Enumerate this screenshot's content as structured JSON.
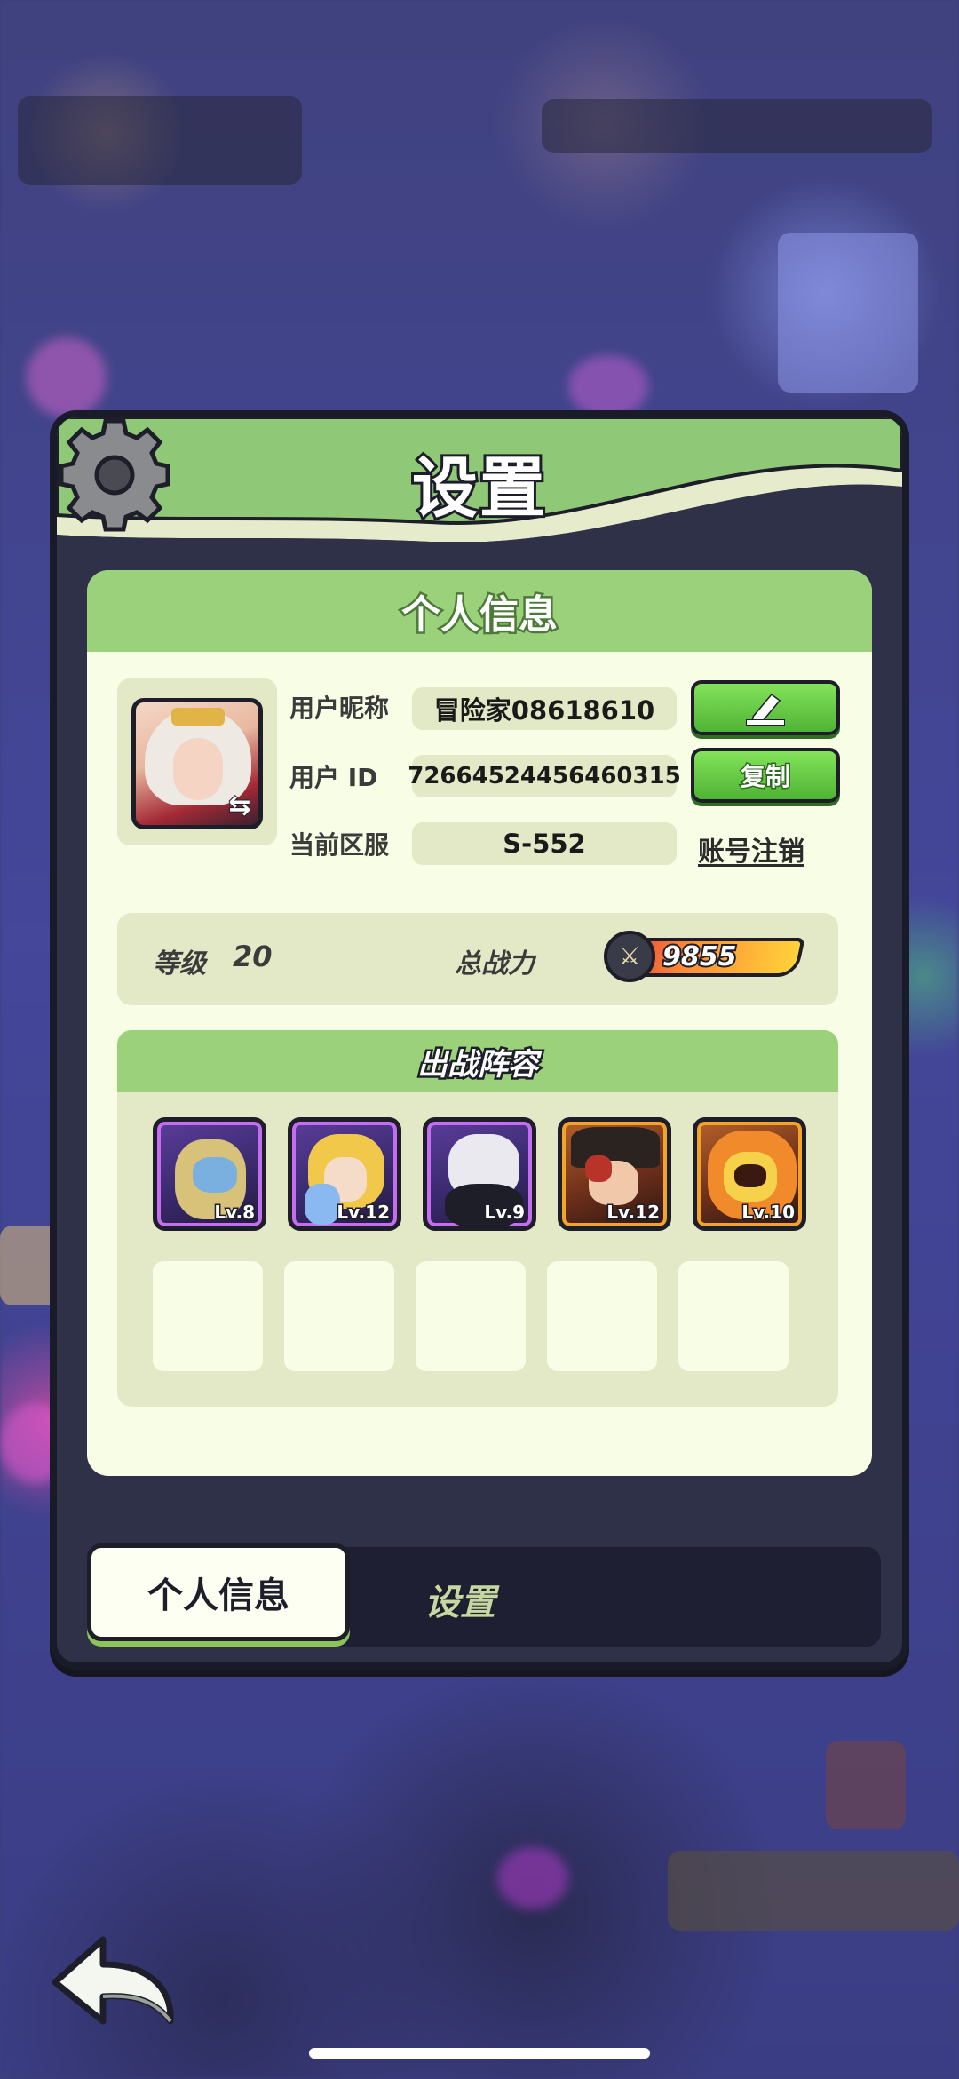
{
  "panel": {
    "title": "设置"
  },
  "profile": {
    "section_title": "个人信息",
    "nickname_label": "用户昵称",
    "nickname_value": "冒险家08618610",
    "edit_label": "",
    "user_id_label": "用户  ID",
    "user_id_value": "72664524456460315",
    "copy_label": "复制",
    "server_label": "当前区服",
    "server_value": "S-552",
    "delete_account_label": "账号注销",
    "swap_glyph": "⇆"
  },
  "stats": {
    "level_label": "等级",
    "level_value": "20",
    "power_label": "总战力",
    "power_value": "9855"
  },
  "lineup": {
    "title": "出战阵容",
    "heroes": [
      {
        "level": "Lv.8",
        "rarity": "purple"
      },
      {
        "level": "Lv.12",
        "rarity": "purple"
      },
      {
        "level": "Lv.9",
        "rarity": "purple"
      },
      {
        "level": "Lv.12",
        "rarity": "orange"
      },
      {
        "level": "Lv.10",
        "rarity": "orange"
      }
    ],
    "empty_slots": 5
  },
  "tabs": {
    "personal_info": "个人信息",
    "settings": "设置"
  },
  "colors": {
    "panel_green": "#9bd17a",
    "card_bg": "#f8fde5",
    "button_green": "#4fb334",
    "purple_frame": "#c46df0",
    "orange_frame": "#f0a42a"
  },
  "icons": {
    "gear": "gear-icon",
    "edit": "pencil-icon",
    "swap": "swap-icon",
    "power": "crossed-swords-icon",
    "back": "back-arrow-icon"
  }
}
